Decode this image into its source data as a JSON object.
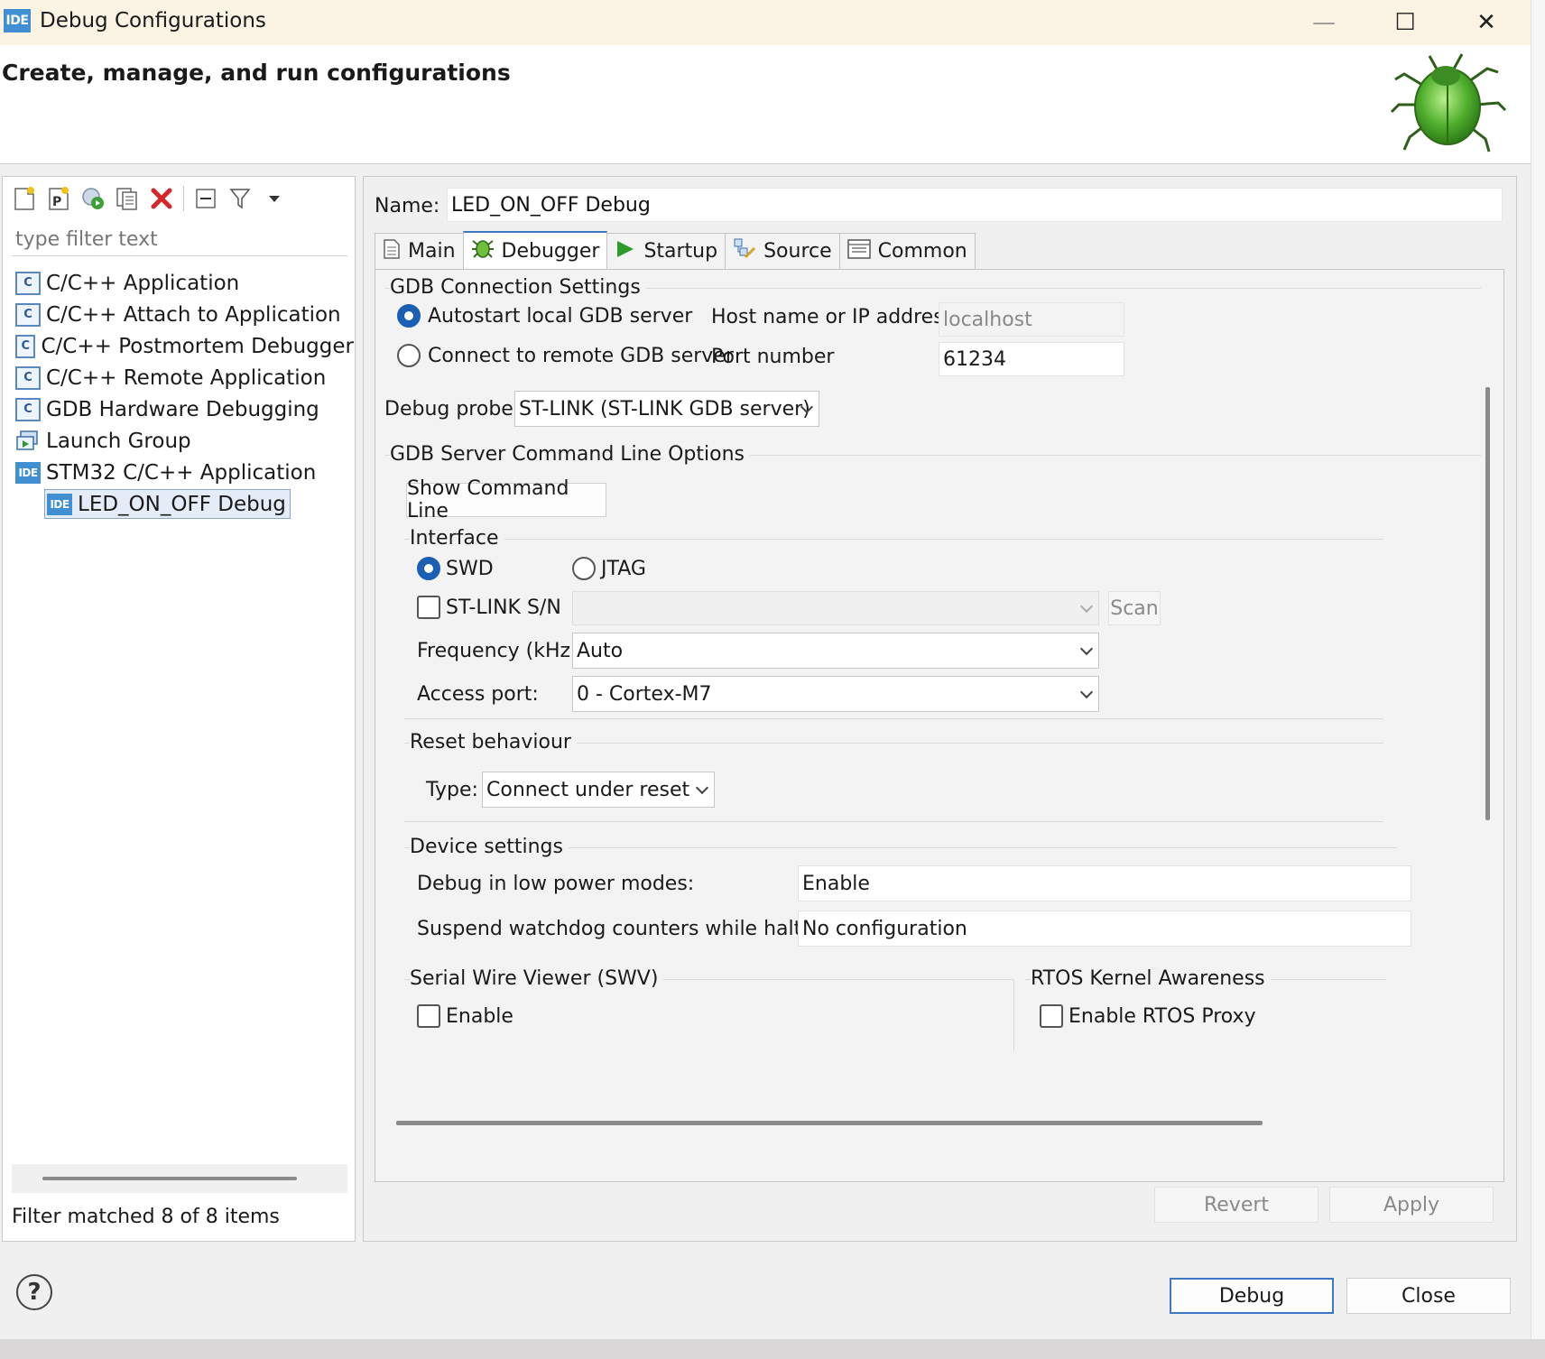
{
  "window": {
    "title": "Debug Configurations",
    "icon_text": "IDE",
    "controls": {
      "minimize": "—",
      "maximize": "☐",
      "close": "✕"
    }
  },
  "header": {
    "title": "Create, manage, and run configurations",
    "icon": "bug-icon"
  },
  "left_pane": {
    "toolbar_icons": [
      "new-configuration-icon",
      "new-prototype-icon",
      "export-icon",
      "duplicate-icon",
      "delete-icon",
      "collapse-all-icon",
      "filter-icon",
      "view-menu-icon"
    ],
    "filter_placeholder": "type filter text",
    "tree": [
      {
        "label": "C/C++ Application",
        "icon": "c-icon"
      },
      {
        "label": "C/C++ Attach to Application",
        "icon": "c-icon"
      },
      {
        "label": "C/C++ Postmortem Debugger",
        "icon": "c-icon"
      },
      {
        "label": "C/C++ Remote Application",
        "icon": "c-icon"
      },
      {
        "label": "GDB Hardware Debugging",
        "icon": "c-icon"
      },
      {
        "label": "Launch Group",
        "icon": "launch-group-icon"
      },
      {
        "label": "STM32 C/C++ Application",
        "icon": "ide-icon"
      },
      {
        "label": "LED_ON_OFF Debug",
        "icon": "ide-icon",
        "selected": true
      }
    ],
    "status": "Filter matched 8 of 8 items"
  },
  "right_pane": {
    "name_label": "Name:",
    "name_value": "LED_ON_OFF Debug",
    "tabs": [
      {
        "label": "Main",
        "icon": "main-tab-icon"
      },
      {
        "label": "Debugger",
        "icon": "debugger-tab-icon",
        "active": true
      },
      {
        "label": "Startup",
        "icon": "startup-tab-icon"
      },
      {
        "label": "Source",
        "icon": "source-tab-icon"
      },
      {
        "label": "Common",
        "icon": "common-tab-icon"
      }
    ],
    "gdb_connection": {
      "title": "GDB Connection Settings",
      "autostart_label": "Autostart local GDB server",
      "autostart_selected": true,
      "remote_label": "Connect to remote GDB server",
      "host_label": "Host name or IP address",
      "host_value": "localhost",
      "port_label": "Port number",
      "port_value": "61234"
    },
    "debug_probe": {
      "label": "Debug probe",
      "value": "ST-LINK (ST-LINK GDB server)"
    },
    "gdb_server_options": {
      "title": "GDB Server Command Line Options",
      "show_button": "Show Command Line"
    },
    "interface": {
      "title": "Interface",
      "swd_label": "SWD",
      "swd_selected": true,
      "jtag_label": "JTAG",
      "stlink_sn_label": "ST-LINK S/N",
      "stlink_sn_value": "",
      "scan_button": "Scan",
      "frequency_label": "Frequency (kHz):",
      "frequency_value": "Auto",
      "access_port_label": "Access port:",
      "access_port_value": "0 - Cortex-M7"
    },
    "reset": {
      "title": "Reset behaviour",
      "type_label": "Type:",
      "type_value": "Connect under reset"
    },
    "device": {
      "title": "Device settings",
      "low_power_label": "Debug in low power modes:",
      "low_power_value": "Enable",
      "watchdog_label": "Suspend watchdog counters while halted:",
      "watchdog_value": "No configuration"
    },
    "swv": {
      "title": "Serial Wire Viewer (SWV)",
      "enable_label": "Enable"
    },
    "rtos": {
      "title": "RTOS Kernel Awareness",
      "enable_label": "Enable RTOS Proxy"
    },
    "revert_button": "Revert",
    "apply_button": "Apply"
  },
  "footer": {
    "help_icon": "?",
    "debug_button": "Debug",
    "close_button": "Close"
  }
}
